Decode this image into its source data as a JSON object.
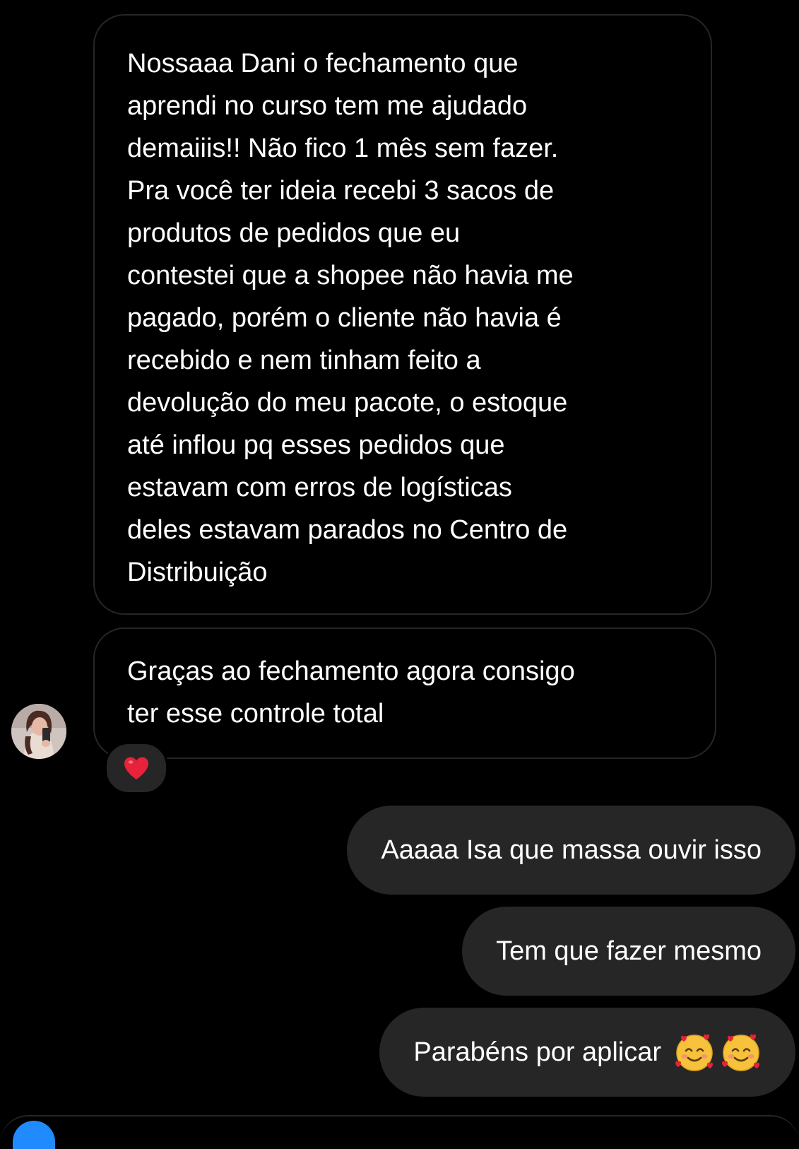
{
  "thread": {
    "incoming": [
      {
        "text": "Nossaaa Dani o fechamento que\naprendi no curso tem me ajudado\ndemaiiis!! Não fico 1 mês sem fazer.\nPra você ter ideia recebi 3 sacos de\nprodutos de pedidos que eu\ncontestei que a shopee não havia me\npagado, porém o cliente não havia é\nrecebido e nem tinham feito a\ndevolução do meu pacote, o estoque\naté inflou pq esses pedidos que\nestavam com erros de logísticas\ndeles estavam parados no Centro de\nDistribuição"
      },
      {
        "text": "Graças ao fechamento agora consigo\nter esse controle total",
        "reaction": "❤️"
      }
    ],
    "outgoing": [
      {
        "text": "Aaaaa Isa que massa ouvir isso"
      },
      {
        "text": "Tem que fazer mesmo"
      },
      {
        "text": "Parabéns por aplicar",
        "emoji": "smiling-face-with-hearts-icon",
        "emoji_count": 2
      }
    ]
  },
  "colors": {
    "background": "#000000",
    "incoming_border": "#262626",
    "outgoing_bubble": "#262626",
    "text": "#ffffff",
    "reaction_heart": "#e8223a",
    "composer_accent": "#1f8bff"
  }
}
